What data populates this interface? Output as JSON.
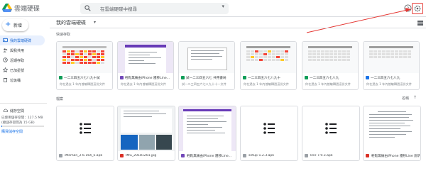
{
  "app": {
    "brand": "雲端硬碟",
    "search_placeholder": "在雲端硬碟中搜尋"
  },
  "colors": {
    "accent": "#1a73e8",
    "annotation": "#e53935",
    "sheets": "#0f9d58",
    "forms": "#7248b9",
    "drive_green": "#0f9d58"
  },
  "icons": {
    "search": "search-icon",
    "help": "help-icon",
    "settings": "gear-icon",
    "grid": "grid-view-icon",
    "list_file": "list-icon"
  },
  "sidebar": {
    "new_label": "新增",
    "items": [
      {
        "label": "我的雲端硬碟",
        "icon": "drive-icon"
      },
      {
        "label": "與我共用",
        "icon": "shared-icon"
      },
      {
        "label": "近期存取",
        "icon": "clock-icon"
      },
      {
        "label": "已加星號",
        "icon": "star-icon"
      },
      {
        "label": "垃圾桶",
        "icon": "trash-icon"
      }
    ],
    "storage_label": "儲存空間",
    "storage_text": "已使用儲存空間：127.5 MB (總儲存空間為 15 GB)",
    "storage_used_fraction": 0.01,
    "buy_storage": "購買儲存空間"
  },
  "main": {
    "title": "我的雲端硬碟",
    "quick_access_label": "快速存取",
    "files_label": "檔案",
    "sort_label": "名稱",
    "quick_access": [
      {
        "name": "一二三四五六七八九十試",
        "subtitle": "你在過去 1 年內曾編輯過這份文件",
        "type": "sheet"
      },
      {
        "name": "輕鬆無痛由iPhone 遷移Line...",
        "subtitle": "你在過去 1 年內曾編輯過這份文件",
        "type": "form"
      },
      {
        "name": "試一二三四五六七 共用書局",
        "subtitle": "試一二三四五六七八九十十一文件",
        "type": "sheet"
      },
      {
        "name": "一二三四五六七八九十",
        "subtitle": "你在過去 1 年內曾編輯過這份文件",
        "type": "sheet"
      },
      {
        "name": "一二三四五六七八九",
        "subtitle": "你在過去 1 年內曾編輯過這份文件",
        "type": "sheet"
      },
      {
        "name": "一二三四五六七八九",
        "subtitle": "你在過去 1 年內曾編輯過這份文件",
        "type": "doc"
      }
    ],
    "files": [
      {
        "name": "iMeman_2.6.164_5.apk",
        "type": "apk"
      },
      {
        "name": "IMG_20181201.jpg",
        "type": "image"
      },
      {
        "name": "輕鬆無痛由iPhone 遷移Line...",
        "type": "form"
      },
      {
        "name": "setup-1.2.3.apk",
        "type": "apk"
      },
      {
        "name": "line-7.9.3.apk",
        "type": "apk"
      },
      {
        "name": "輕鬆無痛由iPhone 遷移Line 說明.docx",
        "type": "doc"
      }
    ]
  }
}
